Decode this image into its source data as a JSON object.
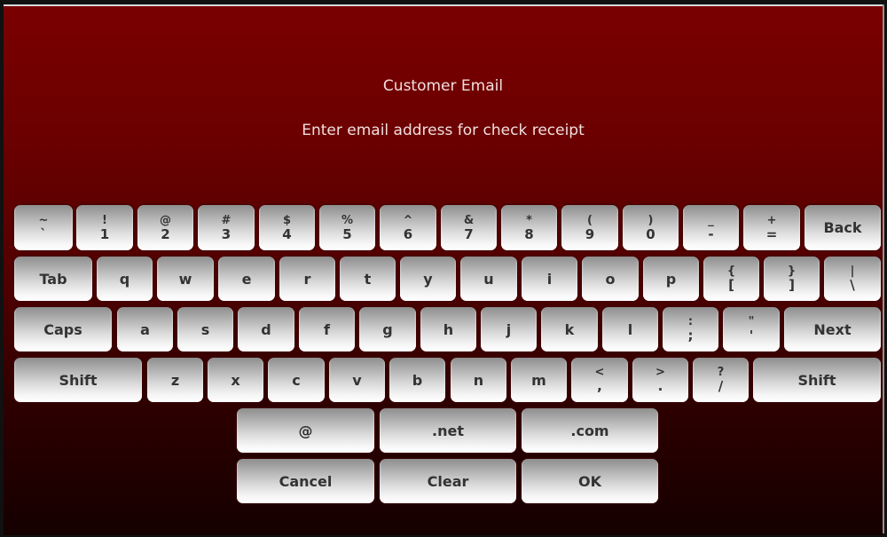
{
  "dialog": {
    "title": "Customer Email",
    "prompt": "Enter email address for check receipt"
  },
  "keyboard": {
    "row1": [
      {
        "top": "~",
        "bot": "`"
      },
      {
        "top": "!",
        "bot": "1"
      },
      {
        "top": "@",
        "bot": "2"
      },
      {
        "top": "#",
        "bot": "3"
      },
      {
        "top": "$",
        "bot": "4"
      },
      {
        "top": "%",
        "bot": "5"
      },
      {
        "top": "^",
        "bot": "6"
      },
      {
        "top": "&",
        "bot": "7"
      },
      {
        "top": "*",
        "bot": "8"
      },
      {
        "top": "(",
        "bot": "9"
      },
      {
        "top": ")",
        "bot": "0"
      },
      {
        "top": "_",
        "bot": "-"
      },
      {
        "top": "+",
        "bot": "="
      },
      {
        "label": "Back"
      }
    ],
    "row2": [
      {
        "label": "Tab"
      },
      {
        "label": "q"
      },
      {
        "label": "w"
      },
      {
        "label": "e"
      },
      {
        "label": "r"
      },
      {
        "label": "t"
      },
      {
        "label": "y"
      },
      {
        "label": "u"
      },
      {
        "label": "i"
      },
      {
        "label": "o"
      },
      {
        "label": "p"
      },
      {
        "top": "{",
        "bot": "["
      },
      {
        "top": "}",
        "bot": "]"
      },
      {
        "top": "|",
        "bot": "\\"
      }
    ],
    "row3": [
      {
        "label": "Caps"
      },
      {
        "label": "a"
      },
      {
        "label": "s"
      },
      {
        "label": "d"
      },
      {
        "label": "f"
      },
      {
        "label": "g"
      },
      {
        "label": "h"
      },
      {
        "label": "j"
      },
      {
        "label": "k"
      },
      {
        "label": "l"
      },
      {
        "top": ":",
        "bot": ";"
      },
      {
        "top": "\"",
        "bot": "'"
      },
      {
        "label": "Next"
      }
    ],
    "row4": [
      {
        "label": "Shift"
      },
      {
        "label": "z"
      },
      {
        "label": "x"
      },
      {
        "label": "c"
      },
      {
        "label": "v"
      },
      {
        "label": "b"
      },
      {
        "label": "n"
      },
      {
        "label": "m"
      },
      {
        "top": "<",
        "bot": ","
      },
      {
        "top": ">",
        "bot": "."
      },
      {
        "top": "?",
        "bot": "/"
      },
      {
        "label": "Shift"
      }
    ],
    "row5": [
      {
        "label": "@"
      },
      {
        "label": ".net"
      },
      {
        "label": ".com"
      }
    ],
    "row6": [
      {
        "label": "Cancel"
      },
      {
        "label": "Clear"
      },
      {
        "label": "OK"
      }
    ]
  }
}
